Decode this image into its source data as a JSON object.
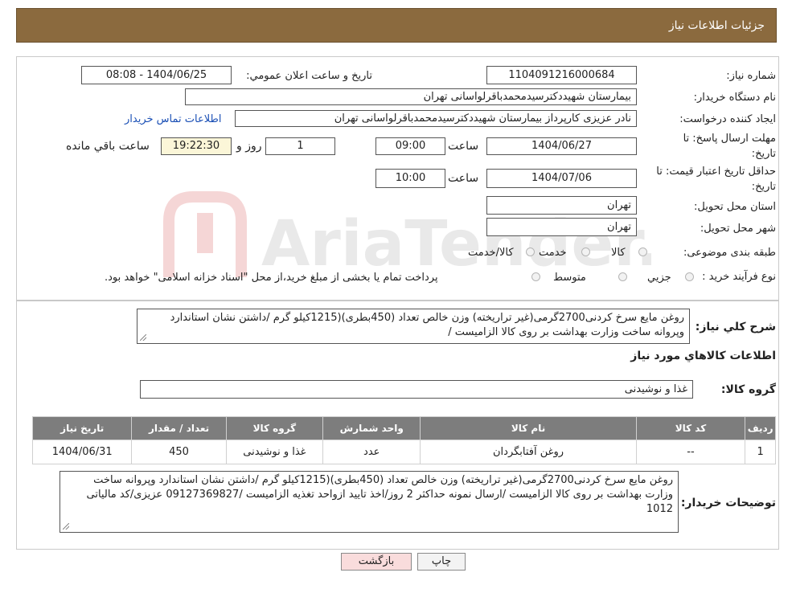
{
  "header": {
    "title": "جزئیات اطلاعات نیاز"
  },
  "form": {
    "need_number_label": "شماره نیاز:",
    "need_number": "1104091216000684",
    "announce_label": "تاریخ و ساعت اعلان عمومي:",
    "announce_value": "1404/06/25 - 08:08",
    "buyer_org_label": "نام دستگاه خريدار:",
    "buyer_org": "بیمارستان شهیددکترسیدمحمدباقرلواسانی تهران",
    "creator_label": "ايجاد كننده درخواست:",
    "creator": "نادر  عزیزی کارپرداز بیمارستان شهیددکترسیدمحمدباقرلواسانی تهران",
    "contact_link": "اطلاعات تماس خريدار",
    "deadline_label_line1": "مهلت ارسال پاسخ: تا",
    "deadline_label_line2": "تاريخ:",
    "deadline_date": "1404/06/27",
    "time_label": "ساعت",
    "deadline_time": "09:00",
    "days_value": "1",
    "days_label": "روز و",
    "remaining_time": "19:22:30",
    "remaining_label": "ساعت باقي مانده",
    "validity_label_line1": "حداقل تاريخ اعتبار قيمت: تا",
    "validity_label_line2": "تاريخ:",
    "validity_date": "1404/07/06",
    "validity_time": "10:00",
    "province_label": "استان محل تحويل:",
    "province": "تهران",
    "city_label": "شهر محل تحويل:",
    "city": "تهران",
    "category_label": "طبقه بندی موضوعی:",
    "category_options": [
      "کالا",
      "خدمت",
      "کالا/خدمت"
    ],
    "process_label": "نوع فرآيند خريد :",
    "process_options": [
      "جزيي",
      "متوسط"
    ],
    "process_note": "پرداخت تمام يا بخشی از مبلغ خريد،از محل \"اسناد خزانه اسلامی\" خواهد بود."
  },
  "summary": {
    "label": "شرح كلي نياز:",
    "text": "روغن مایع سرخ کردنی2700گرمی(غیر تراریخته) وزن خالص تعداد (450بطری)(1215کیلو گرم /داشتن نشان استاندارد وپروانه ساخت وزارت بهداشت بر روی کالا الزامیست /"
  },
  "goods": {
    "section_title": "اطلاعات كالاهاي مورد نياز",
    "group_label": "گروه كالا:",
    "group_value": "غذا و نوشیدنی",
    "table": {
      "headers": [
        "رديف",
        "كد كالا",
        "نام كالا",
        "واحد شمارش",
        "گروه كالا",
        "تعداد / مقدار",
        "تاريخ نياز"
      ],
      "rows": [
        [
          "1",
          "--",
          "روغن آفتابگردان",
          "عدد",
          "غذا و نوشیدنی",
          "450",
          "1404/06/31"
        ]
      ]
    }
  },
  "buyer_notes": {
    "label": "توضيحات خريدار:",
    "text": "روغن مایع سرخ کردنی2700گرمی(غیر تراریخته) وزن خالص تعداد (450بطری)(1215کیلو گرم /داشتن نشان استاندارد وپروانه ساخت وزارت بهداشت بر روی کالا الزامیست /ارسال نمونه حداکثر 2 روز/اخذ تایید ازواحد تغذیه الزامیست /09127369827 عزیزی/کد مالیاتی 1012"
  },
  "buttons": {
    "print": "چاپ",
    "back": "بازگشت"
  },
  "watermark": {
    "text": "AriaTender.neT"
  },
  "colors": {
    "header": "#8b6a3e",
    "table_header": "#7d7d7d",
    "link": "#1a4fb5",
    "back_button": "#f9dcdc"
  }
}
